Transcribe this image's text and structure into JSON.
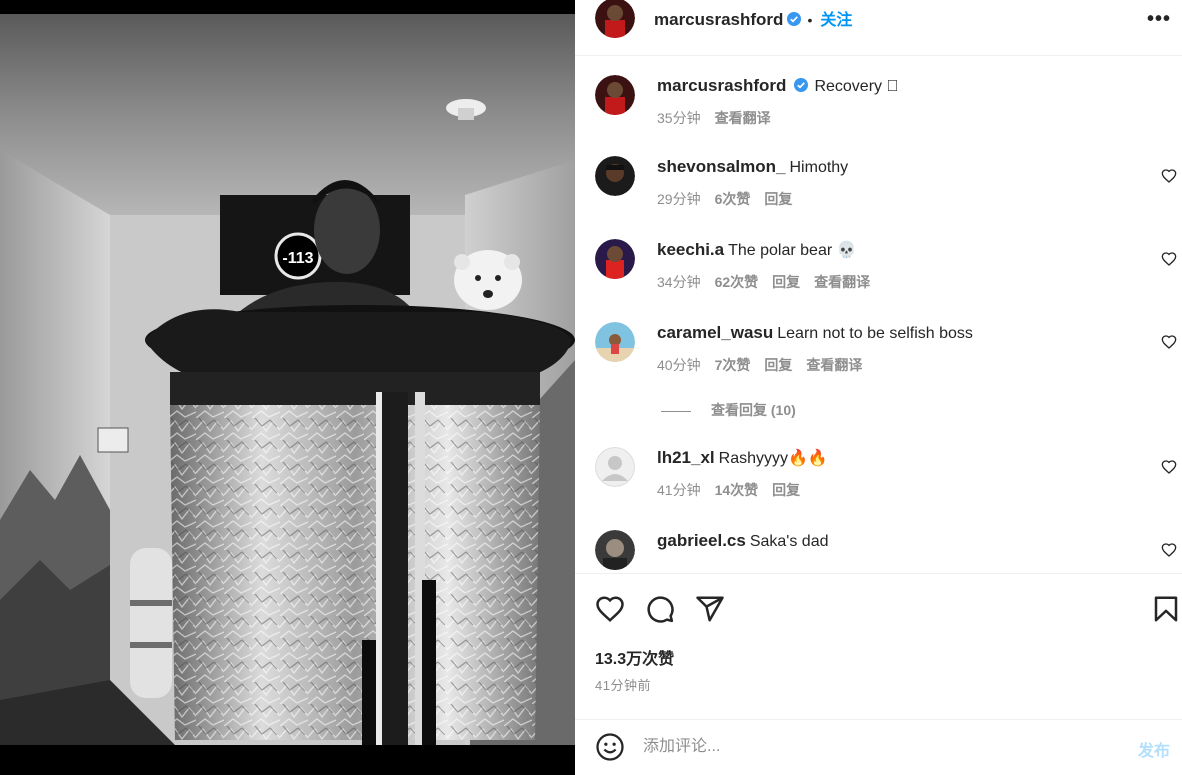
{
  "header": {
    "username": "marcusrashford",
    "separator": "•",
    "follow_label": "关注",
    "more_glyph": "•••"
  },
  "caption": {
    "username": "marcusrashford",
    "text": "Recovery 🏼",
    "time": "35分钟",
    "translate": "查看翻译"
  },
  "comments": [
    {
      "username": "shevonsalmon_",
      "text": "Himothy",
      "time": "29分钟",
      "likes": "6次赞",
      "reply": "回复",
      "translate": ""
    },
    {
      "username": "keechi.a",
      "text": "The polar bear 💀",
      "time": "34分钟",
      "likes": "62次赞",
      "reply": "回复",
      "translate": "查看翻译"
    },
    {
      "username": "caramel_wasu",
      "text": "Learn not to be selfish boss",
      "time": "40分钟",
      "likes": "7次赞",
      "reply": "回复",
      "translate": "查看翻译"
    },
    {
      "username": "lh21_xl",
      "text": "Rashyyyy🔥🔥",
      "time": "41分钟",
      "likes": "14次赞",
      "reply": "回复",
      "translate": ""
    },
    {
      "username": "gabrieel.cs",
      "text": "Saka's dad",
      "time": "",
      "likes": "",
      "reply": "",
      "translate": ""
    }
  ],
  "view_replies": "查看回复 (10)",
  "actions": {
    "like_icon": "heart-icon",
    "comment_icon": "comment-icon",
    "share_icon": "share-icon",
    "save_icon": "bookmark-icon"
  },
  "likes_count": "13.3万次赞",
  "posted": "41分钟前",
  "comment_box": {
    "placeholder": "添加评论...",
    "post_label": "发布"
  },
  "photo": {
    "display_reading": "-113"
  },
  "colors": {
    "accent": "#0095f6",
    "muted": "#8e8e8e",
    "text": "#262626",
    "post_disabled": "#b2dffc"
  }
}
